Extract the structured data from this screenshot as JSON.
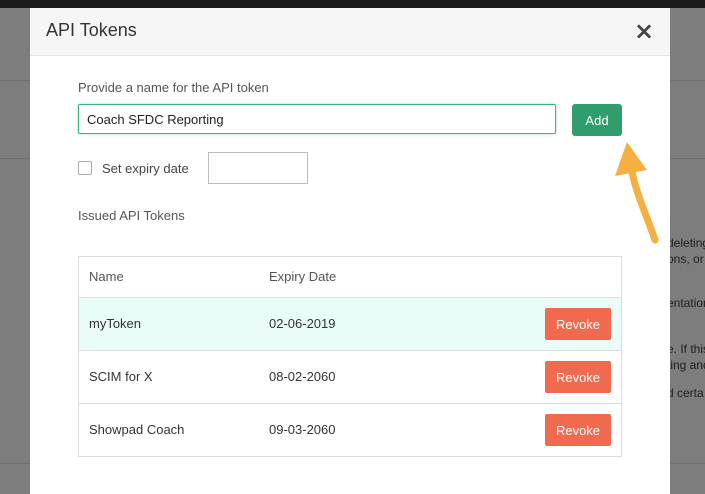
{
  "background": {
    "snippets": [
      "deleting",
      "ons, or",
      "entation",
      "e. If this",
      "ting and",
      "d certa",
      "."
    ]
  },
  "modal": {
    "title": "API Tokens",
    "close_icon": "close-icon",
    "name_label": "Provide a name for the API token",
    "name_value": "Coach SFDC Reporting",
    "add_label": "Add",
    "expiry_label": "Set expiry date",
    "expiry_checked": false,
    "expiry_value": "",
    "issued_label": "Issued API Tokens",
    "table": {
      "columns": [
        "Name",
        "Expiry Date"
      ],
      "rows": [
        {
          "name": "myToken",
          "expiry": "02-06-2019",
          "action": "Revoke"
        },
        {
          "name": "SCIM for X",
          "expiry": "08-02-2060",
          "action": "Revoke"
        },
        {
          "name": "Showpad Coach",
          "expiry": "09-03-2060",
          "action": "Revoke"
        }
      ]
    }
  },
  "colors": {
    "accent_green": "#2f9e6c",
    "input_focus": "#3bb37a",
    "revoke_red": "#ef6a4f",
    "highlight_row": "#eafcf7",
    "annotation_arrow": "#f5b041"
  }
}
